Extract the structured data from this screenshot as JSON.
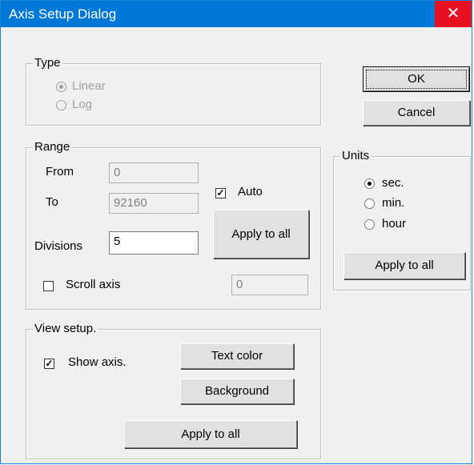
{
  "window": {
    "title": "Axis Setup Dialog",
    "close_glyph": "✕"
  },
  "type_group": {
    "label": "Type",
    "options": [
      {
        "label": "Linear",
        "checked": true
      },
      {
        "label": "Log",
        "checked": false
      }
    ]
  },
  "range_group": {
    "label": "Range",
    "from_label": "From",
    "from_value": "0",
    "to_label": "To",
    "to_value": "92160",
    "auto_label": "Auto",
    "auto_checked": true,
    "divisions_label": "Divisions",
    "divisions_value": "5",
    "apply_label": "Apply to all",
    "scroll_label": "Scroll axis",
    "scroll_checked": false,
    "scroll_value": "0"
  },
  "view_group": {
    "label": "View setup.",
    "show_axis_label": "Show axis.",
    "show_axis_checked": true,
    "text_color_label": "Text color",
    "background_label": "Background",
    "apply_label": "Apply to all"
  },
  "buttons": {
    "ok_label": "OK",
    "cancel_label": "Cancel"
  },
  "units_group": {
    "label": "Units",
    "options": [
      {
        "label": "sec.",
        "checked": true
      },
      {
        "label": "min.",
        "checked": false
      },
      {
        "label": "hour",
        "checked": false
      }
    ],
    "apply_label": "Apply to all"
  },
  "colors": {
    "titlebar": "#0078d7",
    "close": "#e81123",
    "face": "#f0f0f0"
  }
}
